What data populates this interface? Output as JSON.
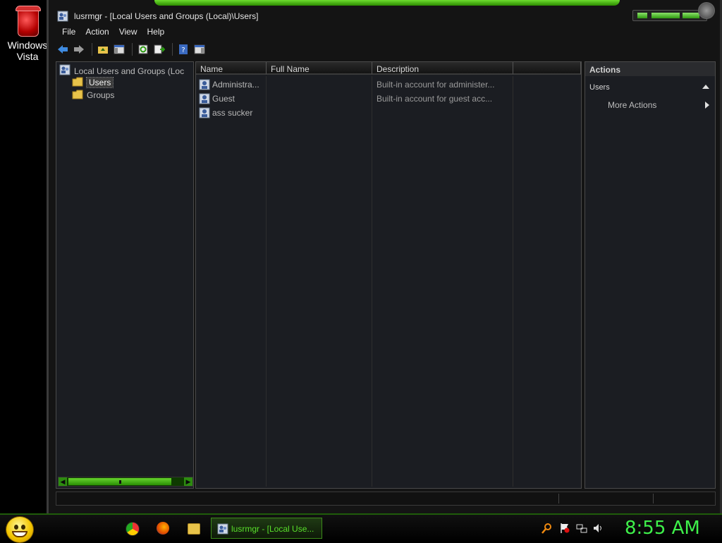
{
  "desktop": {
    "icon_label": "Windows Vista"
  },
  "window": {
    "title": "lusrmgr - [Local Users and Groups (Local)\\Users]"
  },
  "menu": [
    "File",
    "Action",
    "View",
    "Help"
  ],
  "toolbar": [
    "back-arrow-icon",
    "forward-arrow-icon",
    "up-folder-icon",
    "show-hide-tree-icon",
    "refresh-icon",
    "export-list-icon",
    "help-icon",
    "show-hide-action-pane-icon"
  ],
  "tree": {
    "root": "Local Users and Groups (Loc",
    "items": [
      {
        "label": "Users",
        "selected": true
      },
      {
        "label": "Groups",
        "selected": false
      }
    ]
  },
  "list": {
    "columns": [
      "Name",
      "Full Name",
      "Description",
      ""
    ],
    "rows": [
      {
        "name": "Administra...",
        "full_name": "",
        "description": "Built-in account for administer..."
      },
      {
        "name": "Guest",
        "full_name": "",
        "description": "Built-in account for guest acc..."
      },
      {
        "name": "ass sucker",
        "full_name": "",
        "description": ""
      }
    ]
  },
  "actions": {
    "header": "Actions",
    "group": "Users",
    "more": "More Actions"
  },
  "taskbar": {
    "task_label": "lusrmgr - [Local Use...",
    "clock": "8:55 AM",
    "accent": "#3ef04a"
  }
}
